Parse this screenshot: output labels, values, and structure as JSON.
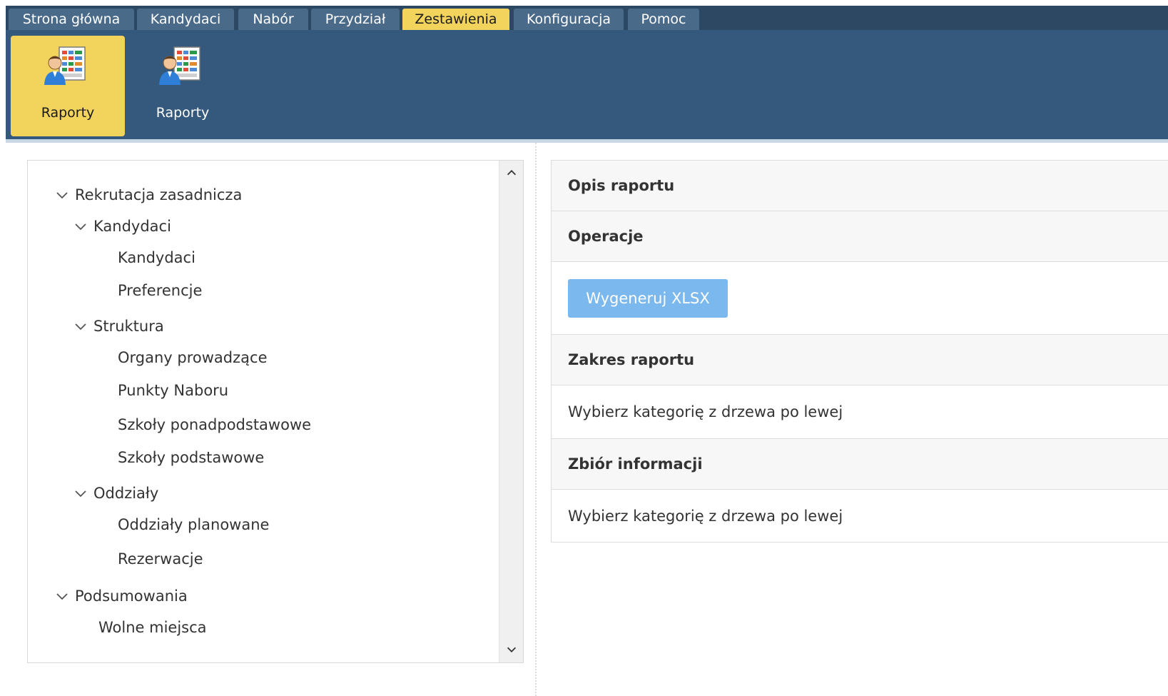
{
  "tabs": [
    {
      "label": "Strona główna",
      "active": false
    },
    {
      "label": "Kandydaci",
      "active": false
    },
    {
      "label": "Nabór",
      "active": false
    },
    {
      "label": "Przydział",
      "active": false
    },
    {
      "label": "Zestawienia",
      "active": true
    },
    {
      "label": "Konfiguracja",
      "active": false
    },
    {
      "label": "Pomoc",
      "active": false
    }
  ],
  "ribbon": {
    "buttons": [
      {
        "label": "Raporty",
        "icon": "report-icon",
        "active": true
      },
      {
        "label": "Raporty",
        "icon": "report-icon",
        "active": false
      }
    ]
  },
  "tree": {
    "items": [
      {
        "label": "Rekrutacja zasadnicza",
        "level": 0,
        "expandable": true
      },
      {
        "label": "Kandydaci",
        "level": 1,
        "expandable": true
      },
      {
        "label": "Kandydaci",
        "level": 2,
        "expandable": false
      },
      {
        "label": "Preferencje",
        "level": 2,
        "expandable": false
      },
      {
        "label": "Struktura",
        "level": 1,
        "expandable": true
      },
      {
        "label": "Organy prowadzące",
        "level": 2,
        "expandable": false
      },
      {
        "label": "Punkty Naboru",
        "level": 2,
        "expandable": false
      },
      {
        "label": "Szkoły ponadpodstawowe",
        "level": 2,
        "expandable": false
      },
      {
        "label": "Szkoły podstawowe",
        "level": 2,
        "expandable": false
      },
      {
        "label": "Oddziały",
        "level": 1,
        "expandable": true
      },
      {
        "label": "Oddziały planowane",
        "level": 2,
        "expandable": false
      },
      {
        "label": "Rezerwacje",
        "level": 2,
        "expandable": false
      },
      {
        "label": "Podsumowania",
        "level": 0,
        "expandable": true
      },
      {
        "label": "Wolne miejsca",
        "level": 1,
        "expandable": false
      }
    ]
  },
  "report": {
    "description_header": "Opis raportu",
    "operations_header": "Operacje",
    "generate_button": "Wygeneruj XLSX",
    "scope_header": "Zakres raportu",
    "scope_text": "Wybierz kategorię z drzewa po lewej",
    "info_header": "Zbiór informacji",
    "info_text": "Wybierz kategorię z drzewa po lewej"
  },
  "colors": {
    "tabbar_bg": "#2c4862",
    "tab_bg": "#4a6a8a",
    "ribbon_bg": "#35597d",
    "active_yellow": "#f2d45c",
    "button_blue": "#7ab8ee"
  }
}
